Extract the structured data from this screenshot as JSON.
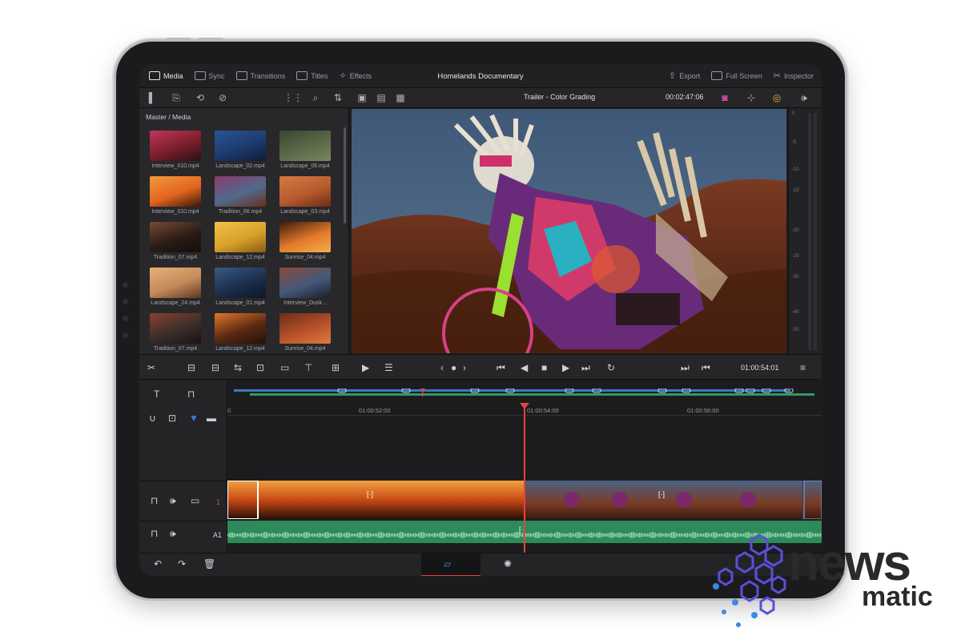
{
  "app": {
    "project_title": "Homelands Documentary",
    "nav": [
      {
        "label": "Media",
        "icon": "media-icon",
        "active": true
      },
      {
        "label": "Sync",
        "icon": "sync-icon",
        "active": false
      },
      {
        "label": "Transitions",
        "icon": "transitions-icon",
        "active": false
      },
      {
        "label": "Titles",
        "icon": "titles-icon",
        "active": false
      },
      {
        "label": "Effects",
        "icon": "effects-icon",
        "active": false
      }
    ],
    "right_nav": [
      {
        "label": "Export",
        "icon": "export-icon"
      },
      {
        "label": "Full Screen",
        "icon": "fullscreen-icon"
      },
      {
        "label": "Inspector",
        "icon": "inspector-icon"
      }
    ]
  },
  "viewer": {
    "clip_title": "Trailer - Color Grading",
    "timecode": "00:02:47:06",
    "playhead_timecode": "01:00:54:01"
  },
  "media": {
    "path": "Master / Media",
    "clips": [
      {
        "name": "Interview_010.mp4",
        "colors": [
          "#7a1e2a",
          "#c3355a",
          "#2a1014"
        ]
      },
      {
        "name": "Landscape_02.mp4",
        "colors": [
          "#1d3a6e",
          "#2b5594",
          "#0e1c35"
        ]
      },
      {
        "name": "Landscape_06.mp4",
        "colors": [
          "#5c6a4a",
          "#3b4530",
          "#7a8460"
        ]
      },
      {
        "name": "Interview_010.mp4",
        "colors": [
          "#e2651f",
          "#f39a3c",
          "#3a1608"
        ]
      },
      {
        "name": "Tradition_06.mp4",
        "colors": [
          "#4f6a8c",
          "#8a3b6c",
          "#6b2f1a"
        ]
      },
      {
        "name": "Landscape_03.mp4",
        "colors": [
          "#b85a2e",
          "#d47a3f",
          "#6a2c16"
        ]
      },
      {
        "name": "Tradition_07.mp4",
        "colors": [
          "#2a1c16",
          "#7a4a34",
          "#150d09"
        ]
      },
      {
        "name": "Landscape_12.mp4",
        "colors": [
          "#d8a12c",
          "#f0c24a",
          "#8a5c14"
        ]
      },
      {
        "name": "Sunrise_04.mp4",
        "colors": [
          "#e27a2a",
          "#3a1a0c",
          "#f5b04a"
        ]
      },
      {
        "name": "Landscape_24.mp4",
        "colors": [
          "#c48a5a",
          "#e6b07a",
          "#5a3a20"
        ]
      },
      {
        "name": "Landscape_01.mp4",
        "colors": [
          "#1c2e4c",
          "#3a5a84",
          "#0c1626"
        ]
      },
      {
        "name": "Interview_Dusk...",
        "colors": [
          "#44587a",
          "#8a4a3a",
          "#1a1e2a"
        ]
      },
      {
        "name": "Tradition_07.mp4",
        "colors": [
          "#3a2e2a",
          "#8a4030",
          "#1a1210"
        ]
      },
      {
        "name": "Landscape_12.mp4",
        "colors": [
          "#5a2a12",
          "#e2762a",
          "#241008"
        ]
      },
      {
        "name": "Sunrise_04.mp4",
        "colors": [
          "#b8512a",
          "#6a2e18",
          "#e07a3c"
        ]
      }
    ]
  },
  "meter": {
    "labels": [
      "0",
      "-5",
      "-10",
      "-15",
      "-20",
      "-25",
      "-30",
      "-40",
      "-50"
    ]
  },
  "timeline": {
    "ruler_marks": [
      {
        "label": "0"
      },
      {
        "label": "01:00:52:00"
      },
      {
        "label": "01:00:54:00"
      },
      {
        "label": "01:00:56:00"
      }
    ],
    "video_track_label": "1",
    "audio_track_label": "A1",
    "transition_marker": "[·]"
  },
  "colors": {
    "accent": "#e2463c",
    "panel_bg": "#1e1e20",
    "audio_track": "#2e8a5b",
    "video_track": "#2a3d5a"
  },
  "watermark": {
    "text_news": "news",
    "text_matic": "matic",
    "color_dots": "#5a4fd8"
  }
}
